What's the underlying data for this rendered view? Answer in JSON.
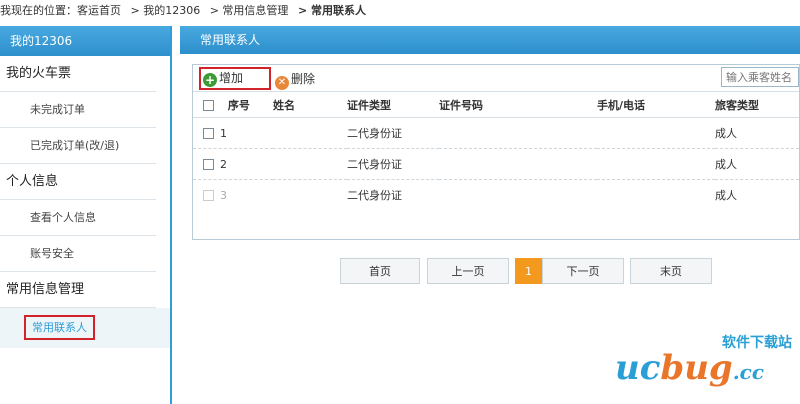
{
  "breadcrumb": {
    "items": [
      "我现在的位置：客运首页",
      "> 我的12306",
      "> 常用信息管理",
      "> 常用联系人"
    ]
  },
  "sidebar": {
    "title": "我的12306",
    "groups": [
      {
        "label": "我的火车票",
        "items": [
          "未完成订单",
          "已完成订单(改/退)"
        ]
      },
      {
        "label": "个人信息",
        "items": [
          "查看个人信息",
          "账号安全"
        ]
      },
      {
        "label": "常用信息管理",
        "items": [
          "常用联系人"
        ]
      }
    ]
  },
  "main": {
    "title": "常用联系人",
    "toolbar": {
      "add_label": "增加",
      "delete_label": "删除",
      "search_placeholder": "输入乘客姓名"
    },
    "table": {
      "headers": [
        "序号",
        "姓名",
        "证件类型",
        "证件号码",
        "手机/电话",
        "旅客类型"
      ],
      "rows": [
        {
          "index": "1",
          "name": "",
          "id_type": "二代身份证",
          "id_no": "",
          "phone": "",
          "type": "成人"
        },
        {
          "index": "2",
          "name": "",
          "id_type": "二代身份证",
          "id_no": "",
          "phone": "",
          "type": "成人"
        },
        {
          "index": "3",
          "name": "",
          "id_type": "二代身份证",
          "id_no": "",
          "phone": "",
          "type": "成人"
        }
      ]
    },
    "pager": {
      "first": "首页",
      "prev": "上一页",
      "current": "1",
      "next": "下一页",
      "last": "末页"
    }
  },
  "watermark": {
    "top": "软件下载站",
    "brand_a": "uc",
    "brand_b": "bug",
    "brand_c": ".cc"
  },
  "colors": {
    "header_blue": "#2d8fcc",
    "highlight_red": "#d3232a",
    "pager_current": "#f39a1e"
  }
}
